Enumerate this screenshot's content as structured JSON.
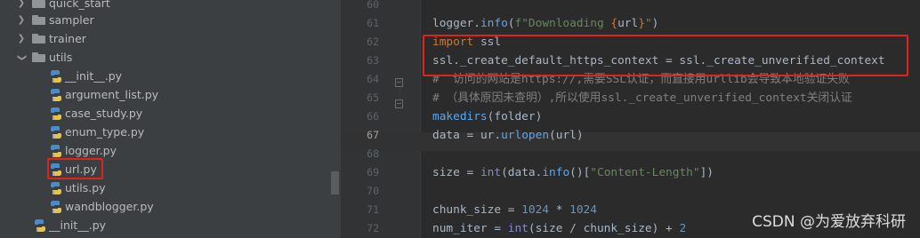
{
  "project_tree": {
    "items": [
      {
        "label": "quick_start",
        "kind": "folder",
        "expanded": false,
        "level": 1
      },
      {
        "label": "sampler",
        "kind": "folder",
        "expanded": false,
        "level": 1
      },
      {
        "label": "trainer",
        "kind": "folder",
        "expanded": false,
        "level": 1
      },
      {
        "label": "utils",
        "kind": "folder",
        "expanded": true,
        "level": 1
      },
      {
        "label": "__init__.py",
        "kind": "py",
        "level": 2
      },
      {
        "label": "argument_list.py",
        "kind": "py",
        "level": 2
      },
      {
        "label": "case_study.py",
        "kind": "py",
        "level": 2
      },
      {
        "label": "enum_type.py",
        "kind": "py",
        "level": 2
      },
      {
        "label": "logger.py",
        "kind": "py",
        "level": 2
      },
      {
        "label": "url.py",
        "kind": "py",
        "level": 2,
        "highlighted": true
      },
      {
        "label": "utils.py",
        "kind": "py",
        "level": 2
      },
      {
        "label": "wandblogger.py",
        "kind": "py",
        "level": 2
      },
      {
        "label": "__init__.py",
        "kind": "py",
        "level": 1
      }
    ]
  },
  "editor": {
    "current_line": "67",
    "lines": [
      {
        "no": "60",
        "code": ""
      },
      {
        "no": "61",
        "code": "logger.info(f\"Downloading {url}\")"
      },
      {
        "no": "62",
        "code": "import ssl"
      },
      {
        "no": "63",
        "code": "ssl._create_default_https_context = ssl._create_unverified_context"
      },
      {
        "no": "64",
        "code": "#  访问的网站是https://,需要SSL认证，而直接用urllib会导致本地验证失败"
      },
      {
        "no": "65",
        "code": "# （具体原因未查明）,所以使用ssl._create_unverified_context关闭认证"
      },
      {
        "no": "66",
        "code": "makedirs(folder)"
      },
      {
        "no": "67",
        "code": "data = ur.urlopen(url)"
      },
      {
        "no": "68",
        "code": ""
      },
      {
        "no": "69",
        "code": "size = int(data.info()[\"Content-Length\"])"
      },
      {
        "no": "70",
        "code": ""
      },
      {
        "no": "71",
        "code": "chunk_size = 1024 * 1024"
      },
      {
        "no": "72",
        "code": "num_iter = int(size / chunk_size) + 2"
      }
    ]
  },
  "colors": {
    "highlight_box": "#e0231b",
    "keyword": "#cc7832",
    "string": "#6a8759",
    "number": "#6897bb",
    "comment": "#808080",
    "call": "#56a8f5"
  },
  "watermark": "CSDN @为爱放弃科研"
}
